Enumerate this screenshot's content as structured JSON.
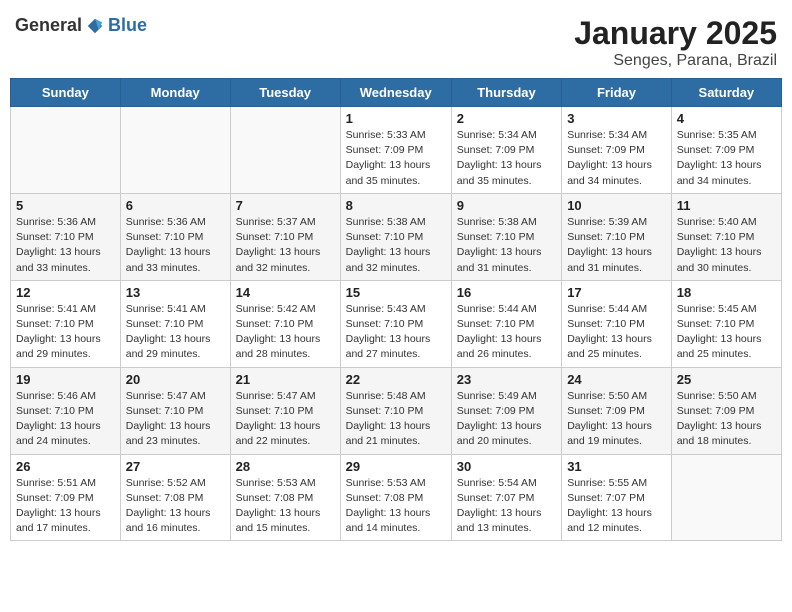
{
  "header": {
    "logo_general": "General",
    "logo_blue": "Blue",
    "month": "January 2025",
    "location": "Senges, Parana, Brazil"
  },
  "weekdays": [
    "Sunday",
    "Monday",
    "Tuesday",
    "Wednesday",
    "Thursday",
    "Friday",
    "Saturday"
  ],
  "weeks": [
    [
      {
        "day": "",
        "info": ""
      },
      {
        "day": "",
        "info": ""
      },
      {
        "day": "",
        "info": ""
      },
      {
        "day": "1",
        "info": "Sunrise: 5:33 AM\nSunset: 7:09 PM\nDaylight: 13 hours and 35 minutes."
      },
      {
        "day": "2",
        "info": "Sunrise: 5:34 AM\nSunset: 7:09 PM\nDaylight: 13 hours and 35 minutes."
      },
      {
        "day": "3",
        "info": "Sunrise: 5:34 AM\nSunset: 7:09 PM\nDaylight: 13 hours and 34 minutes."
      },
      {
        "day": "4",
        "info": "Sunrise: 5:35 AM\nSunset: 7:09 PM\nDaylight: 13 hours and 34 minutes."
      }
    ],
    [
      {
        "day": "5",
        "info": "Sunrise: 5:36 AM\nSunset: 7:10 PM\nDaylight: 13 hours and 33 minutes."
      },
      {
        "day": "6",
        "info": "Sunrise: 5:36 AM\nSunset: 7:10 PM\nDaylight: 13 hours and 33 minutes."
      },
      {
        "day": "7",
        "info": "Sunrise: 5:37 AM\nSunset: 7:10 PM\nDaylight: 13 hours and 32 minutes."
      },
      {
        "day": "8",
        "info": "Sunrise: 5:38 AM\nSunset: 7:10 PM\nDaylight: 13 hours and 32 minutes."
      },
      {
        "day": "9",
        "info": "Sunrise: 5:38 AM\nSunset: 7:10 PM\nDaylight: 13 hours and 31 minutes."
      },
      {
        "day": "10",
        "info": "Sunrise: 5:39 AM\nSunset: 7:10 PM\nDaylight: 13 hours and 31 minutes."
      },
      {
        "day": "11",
        "info": "Sunrise: 5:40 AM\nSunset: 7:10 PM\nDaylight: 13 hours and 30 minutes."
      }
    ],
    [
      {
        "day": "12",
        "info": "Sunrise: 5:41 AM\nSunset: 7:10 PM\nDaylight: 13 hours and 29 minutes."
      },
      {
        "day": "13",
        "info": "Sunrise: 5:41 AM\nSunset: 7:10 PM\nDaylight: 13 hours and 29 minutes."
      },
      {
        "day": "14",
        "info": "Sunrise: 5:42 AM\nSunset: 7:10 PM\nDaylight: 13 hours and 28 minutes."
      },
      {
        "day": "15",
        "info": "Sunrise: 5:43 AM\nSunset: 7:10 PM\nDaylight: 13 hours and 27 minutes."
      },
      {
        "day": "16",
        "info": "Sunrise: 5:44 AM\nSunset: 7:10 PM\nDaylight: 13 hours and 26 minutes."
      },
      {
        "day": "17",
        "info": "Sunrise: 5:44 AM\nSunset: 7:10 PM\nDaylight: 13 hours and 25 minutes."
      },
      {
        "day": "18",
        "info": "Sunrise: 5:45 AM\nSunset: 7:10 PM\nDaylight: 13 hours and 25 minutes."
      }
    ],
    [
      {
        "day": "19",
        "info": "Sunrise: 5:46 AM\nSunset: 7:10 PM\nDaylight: 13 hours and 24 minutes."
      },
      {
        "day": "20",
        "info": "Sunrise: 5:47 AM\nSunset: 7:10 PM\nDaylight: 13 hours and 23 minutes."
      },
      {
        "day": "21",
        "info": "Sunrise: 5:47 AM\nSunset: 7:10 PM\nDaylight: 13 hours and 22 minutes."
      },
      {
        "day": "22",
        "info": "Sunrise: 5:48 AM\nSunset: 7:10 PM\nDaylight: 13 hours and 21 minutes."
      },
      {
        "day": "23",
        "info": "Sunrise: 5:49 AM\nSunset: 7:09 PM\nDaylight: 13 hours and 20 minutes."
      },
      {
        "day": "24",
        "info": "Sunrise: 5:50 AM\nSunset: 7:09 PM\nDaylight: 13 hours and 19 minutes."
      },
      {
        "day": "25",
        "info": "Sunrise: 5:50 AM\nSunset: 7:09 PM\nDaylight: 13 hours and 18 minutes."
      }
    ],
    [
      {
        "day": "26",
        "info": "Sunrise: 5:51 AM\nSunset: 7:09 PM\nDaylight: 13 hours and 17 minutes."
      },
      {
        "day": "27",
        "info": "Sunrise: 5:52 AM\nSunset: 7:08 PM\nDaylight: 13 hours and 16 minutes."
      },
      {
        "day": "28",
        "info": "Sunrise: 5:53 AM\nSunset: 7:08 PM\nDaylight: 13 hours and 15 minutes."
      },
      {
        "day": "29",
        "info": "Sunrise: 5:53 AM\nSunset: 7:08 PM\nDaylight: 13 hours and 14 minutes."
      },
      {
        "day": "30",
        "info": "Sunrise: 5:54 AM\nSunset: 7:07 PM\nDaylight: 13 hours and 13 minutes."
      },
      {
        "day": "31",
        "info": "Sunrise: 5:55 AM\nSunset: 7:07 PM\nDaylight: 13 hours and 12 minutes."
      },
      {
        "day": "",
        "info": ""
      }
    ]
  ]
}
